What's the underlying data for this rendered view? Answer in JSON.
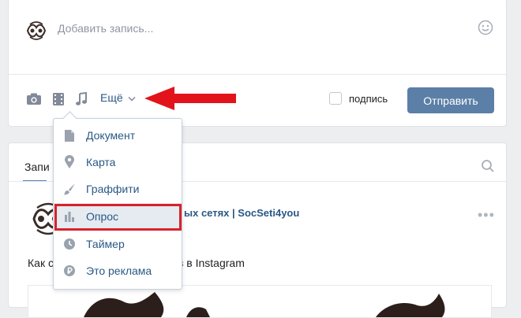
{
  "composer": {
    "placeholder": "Добавить запись...",
    "more_label": "Ещё",
    "signature_label": "подпись",
    "send_label": "Отправить",
    "tools": [
      "camera-icon",
      "video-icon",
      "music-icon"
    ]
  },
  "feed": {
    "tab_label": "Запи",
    "post_author": "ых сетях | SocSeti4you",
    "post_text": "Как с                ковых запросов в Instagram"
  },
  "menu": {
    "items": [
      {
        "label": "Документ",
        "icon": "document-icon"
      },
      {
        "label": "Карта",
        "icon": "map-pin-icon"
      },
      {
        "label": "Граффити",
        "icon": "brush-icon"
      },
      {
        "label": "Опрос",
        "icon": "poll-icon"
      },
      {
        "label": "Таймер",
        "icon": "clock-icon"
      },
      {
        "label": "Это реклама",
        "icon": "ruble-icon"
      }
    ],
    "highlighted_item": "Опрос"
  },
  "colors": {
    "accent": "#5181b8",
    "link": "#2a5885",
    "send_button": "#5b7fa6",
    "annotation_red": "#e3131b",
    "background": "#edeef0"
  }
}
